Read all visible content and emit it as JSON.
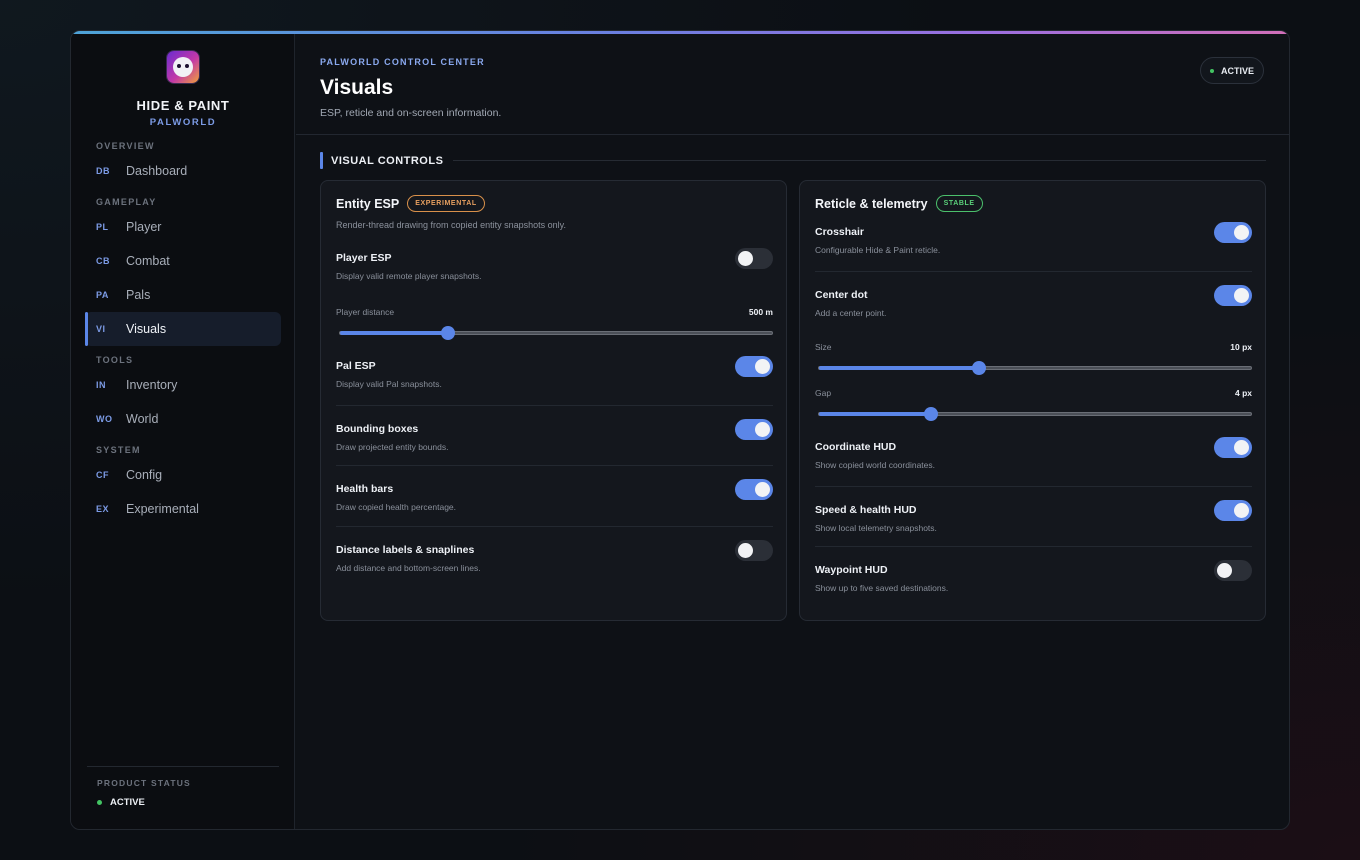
{
  "brand": {
    "title": "HIDE & PAINT",
    "subtitle": "PALWORLD",
    "logo_icon": "pal-mascot-icon"
  },
  "nav": {
    "groups": [
      {
        "label": "OVERVIEW",
        "items": [
          {
            "code": "DB",
            "label": "Dashboard"
          }
        ]
      },
      {
        "label": "GAMEPLAY",
        "items": [
          {
            "code": "PL",
            "label": "Player"
          },
          {
            "code": "CB",
            "label": "Combat"
          },
          {
            "code": "PA",
            "label": "Pals"
          },
          {
            "code": "VI",
            "label": "Visuals",
            "active": true
          }
        ]
      },
      {
        "label": "TOOLS",
        "items": [
          {
            "code": "IN",
            "label": "Inventory"
          },
          {
            "code": "WO",
            "label": "World"
          }
        ]
      },
      {
        "label": "SYSTEM",
        "items": [
          {
            "code": "CF",
            "label": "Config"
          },
          {
            "code": "EX",
            "label": "Experimental"
          }
        ]
      }
    ]
  },
  "sidebar_footer": {
    "label": "PRODUCT STATUS",
    "status": "ACTIVE"
  },
  "header": {
    "kicker": "PALWORLD CONTROL CENTER",
    "title": "Visuals",
    "subtitle": "ESP, reticle and on-screen information.",
    "status_pill": "ACTIVE"
  },
  "section": {
    "title": "VISUAL CONTROLS"
  },
  "cards": {
    "esp": {
      "title": "Entity ESP",
      "badge": "EXPERIMENTAL",
      "description": "Render-thread drawing from copied entity snapshots only.",
      "player_esp": {
        "title": "Player ESP",
        "desc": "Display valid remote player snapshots.",
        "on": false
      },
      "player_distance": {
        "label": "Player distance",
        "value": "500 m",
        "fraction": 0.25
      },
      "pal_esp": {
        "title": "Pal ESP",
        "desc": "Display valid Pal snapshots.",
        "on": true
      },
      "bounding_boxes": {
        "title": "Bounding boxes",
        "desc": "Draw projected entity bounds.",
        "on": true
      },
      "health_bars": {
        "title": "Health bars",
        "desc": "Draw copied health percentage.",
        "on": true
      },
      "distance_labels": {
        "title": "Distance labels & snaplines",
        "desc": "Add distance and bottom-screen lines.",
        "on": false
      }
    },
    "reticle": {
      "title": "Reticle & telemetry",
      "badge": "STABLE",
      "crosshair": {
        "title": "Crosshair",
        "desc": "Configurable Hide & Paint reticle.",
        "on": true
      },
      "center_dot": {
        "title": "Center dot",
        "desc": "Add a center point.",
        "on": true
      },
      "size": {
        "label": "Size",
        "value": "10 px",
        "fraction": 0.37
      },
      "gap": {
        "label": "Gap",
        "value": "4 px",
        "fraction": 0.26
      },
      "coordinate_hud": {
        "title": "Coordinate HUD",
        "desc": "Show copied world coordinates.",
        "on": true
      },
      "speed_health_hud": {
        "title": "Speed & health HUD",
        "desc": "Show local telemetry snapshots.",
        "on": true
      },
      "waypoint_hud": {
        "title": "Waypoint HUD",
        "desc": "Show up to five saved destinations.",
        "on": false
      }
    }
  },
  "colors": {
    "accent": "#5b86e8",
    "status_green": "#43c463",
    "experimental": "#e8a060",
    "stable": "#5ad07a"
  }
}
